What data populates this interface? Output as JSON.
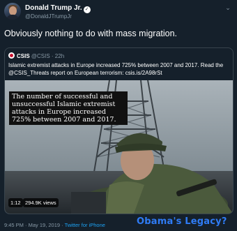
{
  "tweet": {
    "author_name": "Donald Trump Jr.",
    "handle": "@DonaldJTrumpJr",
    "text": "Obviously nothing to do with mass migration.",
    "timestamp": "9:45 PM · May 19, 2019 ·",
    "client": "Twitter for iPhone"
  },
  "quoted": {
    "author_name": "CSIS",
    "handle_time": "@CSIS · 22h",
    "text": "Islamic extremist attacks in Europe increased 725% between 2007 and 2017. Read the @CSIS_Threats report on European terrorism: csis.is/2A98rSt",
    "media": {
      "caption": "The number of successful and unsuccessful Islamic extremist attacks in Europe increased 725% between 2007 and 2017.",
      "duration": "1:12",
      "views": "294.9K views"
    }
  },
  "overlay_annotation": "Obama's  Legacy?",
  "icons": {
    "verified": "verified-badge-icon",
    "menu": "chevron-down-icon",
    "logo": "csis-logo-icon"
  },
  "colors": {
    "background": "#15202b",
    "secondary_text": "#8899a6",
    "link": "#1da1f2",
    "annotation": "#2f7cf6"
  }
}
